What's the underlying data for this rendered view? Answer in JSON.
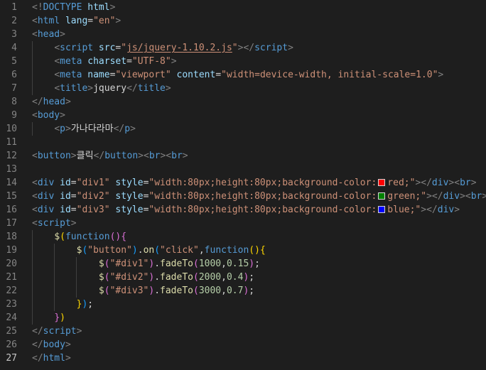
{
  "colors": {
    "background": "#1e1e1e",
    "gutter": "#858585",
    "gutter_active": "#c6c6c6",
    "tag_bracket": "#808080",
    "tag": "#569cd6",
    "attr": "#9cdcfe",
    "string": "#ce9178",
    "text": "#d4d4d4",
    "func": "#dcdcaa",
    "number": "#b5cea8",
    "bracket_gold": "#ffd700",
    "bracket_pink": "#da70d6",
    "bracket_blue": "#179fff"
  },
  "current_line": 27,
  "lines": [
    {
      "num": "1",
      "tokens": [
        {
          "t": "<!",
          "c": "tag_bracket"
        },
        {
          "t": "DOCTYPE",
          "c": "tag"
        },
        {
          "t": " html",
          "c": "attr"
        },
        {
          "t": ">",
          "c": "tag_bracket"
        }
      ]
    },
    {
      "num": "2",
      "tokens": [
        {
          "t": "<",
          "c": "tag_bracket"
        },
        {
          "t": "html",
          "c": "tag"
        },
        {
          "t": " lang",
          "c": "attr"
        },
        {
          "t": "=",
          "c": "text"
        },
        {
          "t": "\"en\"",
          "c": "string"
        },
        {
          "t": ">",
          "c": "tag_bracket"
        }
      ]
    },
    {
      "num": "3",
      "tokens": [
        {
          "t": "<",
          "c": "tag_bracket"
        },
        {
          "t": "head",
          "c": "tag"
        },
        {
          "t": ">",
          "c": "tag_bracket"
        }
      ]
    },
    {
      "num": "4",
      "tokens": [
        {
          "t": "    ",
          "c": "text"
        },
        {
          "t": "<",
          "c": "tag_bracket"
        },
        {
          "t": "script",
          "c": "tag"
        },
        {
          "t": " src",
          "c": "attr"
        },
        {
          "t": "=",
          "c": "text"
        },
        {
          "t": "\"",
          "c": "string"
        },
        {
          "t": "js/jquery-1.10.2.js",
          "c": "string",
          "u": true
        },
        {
          "t": "\"",
          "c": "string"
        },
        {
          "t": "></",
          "c": "tag_bracket"
        },
        {
          "t": "script",
          "c": "tag"
        },
        {
          "t": ">",
          "c": "tag_bracket"
        }
      ]
    },
    {
      "num": "5",
      "tokens": [
        {
          "t": "    ",
          "c": "text"
        },
        {
          "t": "<",
          "c": "tag_bracket"
        },
        {
          "t": "meta",
          "c": "tag"
        },
        {
          "t": " charset",
          "c": "attr"
        },
        {
          "t": "=",
          "c": "text"
        },
        {
          "t": "\"UTF-8\"",
          "c": "string"
        },
        {
          "t": ">",
          "c": "tag_bracket"
        }
      ]
    },
    {
      "num": "6",
      "tokens": [
        {
          "t": "    ",
          "c": "text"
        },
        {
          "t": "<",
          "c": "tag_bracket"
        },
        {
          "t": "meta",
          "c": "tag"
        },
        {
          "t": " name",
          "c": "attr"
        },
        {
          "t": "=",
          "c": "text"
        },
        {
          "t": "\"viewport\"",
          "c": "string"
        },
        {
          "t": " content",
          "c": "attr"
        },
        {
          "t": "=",
          "c": "text"
        },
        {
          "t": "\"width=device-width, initial-scale=1.0\"",
          "c": "string"
        },
        {
          "t": ">",
          "c": "tag_bracket"
        }
      ]
    },
    {
      "num": "7",
      "tokens": [
        {
          "t": "    ",
          "c": "text"
        },
        {
          "t": "<",
          "c": "tag_bracket"
        },
        {
          "t": "title",
          "c": "tag"
        },
        {
          "t": ">",
          "c": "tag_bracket"
        },
        {
          "t": "jquery",
          "c": "text"
        },
        {
          "t": "</",
          "c": "tag_bracket"
        },
        {
          "t": "title",
          "c": "tag"
        },
        {
          "t": ">",
          "c": "tag_bracket"
        }
      ]
    },
    {
      "num": "8",
      "tokens": [
        {
          "t": "</",
          "c": "tag_bracket"
        },
        {
          "t": "head",
          "c": "tag"
        },
        {
          "t": ">",
          "c": "tag_bracket"
        }
      ]
    },
    {
      "num": "9",
      "tokens": [
        {
          "t": "<",
          "c": "tag_bracket"
        },
        {
          "t": "body",
          "c": "tag"
        },
        {
          "t": ">",
          "c": "tag_bracket"
        }
      ]
    },
    {
      "num": "10",
      "tokens": [
        {
          "t": "    ",
          "c": "text"
        },
        {
          "t": "<",
          "c": "tag_bracket"
        },
        {
          "t": "p",
          "c": "tag"
        },
        {
          "t": ">",
          "c": "tag_bracket"
        },
        {
          "t": "가나다라마",
          "c": "text"
        },
        {
          "t": "</",
          "c": "tag_bracket"
        },
        {
          "t": "p",
          "c": "tag"
        },
        {
          "t": ">",
          "c": "tag_bracket"
        }
      ]
    },
    {
      "num": "11",
      "tokens": []
    },
    {
      "num": "12",
      "tokens": [
        {
          "t": "<",
          "c": "tag_bracket"
        },
        {
          "t": "button",
          "c": "tag"
        },
        {
          "t": ">",
          "c": "tag_bracket"
        },
        {
          "t": "클릭",
          "c": "text"
        },
        {
          "t": "</",
          "c": "tag_bracket"
        },
        {
          "t": "button",
          "c": "tag"
        },
        {
          "t": "><",
          "c": "tag_bracket"
        },
        {
          "t": "br",
          "c": "tag"
        },
        {
          "t": "><",
          "c": "tag_bracket"
        },
        {
          "t": "br",
          "c": "tag"
        },
        {
          "t": ">",
          "c": "tag_bracket"
        }
      ]
    },
    {
      "num": "13",
      "tokens": []
    },
    {
      "num": "14",
      "tokens": [
        {
          "t": "<",
          "c": "tag_bracket"
        },
        {
          "t": "div",
          "c": "tag"
        },
        {
          "t": " id",
          "c": "attr"
        },
        {
          "t": "=",
          "c": "text"
        },
        {
          "t": "\"div1\"",
          "c": "string"
        },
        {
          "t": " style",
          "c": "attr"
        },
        {
          "t": "=",
          "c": "text"
        },
        {
          "t": "\"width:80px;height:80px;background-color:",
          "c": "string"
        },
        {
          "t": "",
          "c": "swatch",
          "color": "#ff0000"
        },
        {
          "t": "red;\"",
          "c": "string"
        },
        {
          "t": "></",
          "c": "tag_bracket"
        },
        {
          "t": "div",
          "c": "tag"
        },
        {
          "t": "><",
          "c": "tag_bracket"
        },
        {
          "t": "br",
          "c": "tag"
        },
        {
          "t": ">",
          "c": "tag_bracket"
        }
      ]
    },
    {
      "num": "15",
      "tokens": [
        {
          "t": "<",
          "c": "tag_bracket"
        },
        {
          "t": "div",
          "c": "tag"
        },
        {
          "t": " id",
          "c": "attr"
        },
        {
          "t": "=",
          "c": "text"
        },
        {
          "t": "\"div2\"",
          "c": "string"
        },
        {
          "t": " style",
          "c": "attr"
        },
        {
          "t": "=",
          "c": "text"
        },
        {
          "t": "\"width:80px;height:80px;background-color:",
          "c": "string"
        },
        {
          "t": "",
          "c": "swatch",
          "color": "#008000"
        },
        {
          "t": "green;\"",
          "c": "string"
        },
        {
          "t": "></",
          "c": "tag_bracket"
        },
        {
          "t": "div",
          "c": "tag"
        },
        {
          "t": "><",
          "c": "tag_bracket"
        },
        {
          "t": "br",
          "c": "tag"
        },
        {
          "t": ">",
          "c": "tag_bracket"
        }
      ]
    },
    {
      "num": "16",
      "tokens": [
        {
          "t": "<",
          "c": "tag_bracket"
        },
        {
          "t": "div",
          "c": "tag"
        },
        {
          "t": " id",
          "c": "attr"
        },
        {
          "t": "=",
          "c": "text"
        },
        {
          "t": "\"div3\"",
          "c": "string"
        },
        {
          "t": " style",
          "c": "attr"
        },
        {
          "t": "=",
          "c": "text"
        },
        {
          "t": "\"width:80px;height:80px;background-color:",
          "c": "string"
        },
        {
          "t": "",
          "c": "swatch",
          "color": "#0000ff"
        },
        {
          "t": "blue;\"",
          "c": "string"
        },
        {
          "t": "></",
          "c": "tag_bracket"
        },
        {
          "t": "div",
          "c": "tag"
        },
        {
          "t": ">",
          "c": "tag_bracket"
        }
      ]
    },
    {
      "num": "17",
      "tokens": [
        {
          "t": "<",
          "c": "tag_bracket"
        },
        {
          "t": "script",
          "c": "tag"
        },
        {
          "t": ">",
          "c": "tag_bracket"
        }
      ]
    },
    {
      "num": "18",
      "tokens": [
        {
          "t": "    ",
          "c": "text"
        },
        {
          "t": "$",
          "c": "func"
        },
        {
          "t": "(",
          "c": "bracket_gold"
        },
        {
          "t": "function",
          "c": "tag"
        },
        {
          "t": "()",
          "c": "bracket_pink"
        },
        {
          "t": "{",
          "c": "bracket_pink"
        }
      ]
    },
    {
      "num": "19",
      "tokens": [
        {
          "t": "        ",
          "c": "text"
        },
        {
          "t": "$",
          "c": "func"
        },
        {
          "t": "(",
          "c": "bracket_blue"
        },
        {
          "t": "\"button\"",
          "c": "string"
        },
        {
          "t": ")",
          "c": "bracket_blue"
        },
        {
          "t": ".",
          "c": "text"
        },
        {
          "t": "on",
          "c": "func"
        },
        {
          "t": "(",
          "c": "bracket_blue"
        },
        {
          "t": "\"click\"",
          "c": "string"
        },
        {
          "t": ",",
          "c": "text"
        },
        {
          "t": "function",
          "c": "tag"
        },
        {
          "t": "()",
          "c": "bracket_gold"
        },
        {
          "t": "{",
          "c": "bracket_gold"
        }
      ]
    },
    {
      "num": "20",
      "tokens": [
        {
          "t": "            ",
          "c": "text"
        },
        {
          "t": "$",
          "c": "func"
        },
        {
          "t": "(",
          "c": "bracket_pink"
        },
        {
          "t": "\"#div1\"",
          "c": "string"
        },
        {
          "t": ")",
          "c": "bracket_pink"
        },
        {
          "t": ".",
          "c": "text"
        },
        {
          "t": "fadeTo",
          "c": "func"
        },
        {
          "t": "(",
          "c": "bracket_pink"
        },
        {
          "t": "1000",
          "c": "number"
        },
        {
          "t": ",",
          "c": "text"
        },
        {
          "t": "0.15",
          "c": "number"
        },
        {
          "t": ")",
          "c": "bracket_pink"
        },
        {
          "t": ";",
          "c": "text"
        }
      ]
    },
    {
      "num": "21",
      "tokens": [
        {
          "t": "            ",
          "c": "text"
        },
        {
          "t": "$",
          "c": "func"
        },
        {
          "t": "(",
          "c": "bracket_pink"
        },
        {
          "t": "\"#div2\"",
          "c": "string"
        },
        {
          "t": ")",
          "c": "bracket_pink"
        },
        {
          "t": ".",
          "c": "text"
        },
        {
          "t": "fadeTo",
          "c": "func"
        },
        {
          "t": "(",
          "c": "bracket_pink"
        },
        {
          "t": "2000",
          "c": "number"
        },
        {
          "t": ",",
          "c": "text"
        },
        {
          "t": "0.4",
          "c": "number"
        },
        {
          "t": ")",
          "c": "bracket_pink"
        },
        {
          "t": ";",
          "c": "text"
        }
      ]
    },
    {
      "num": "22",
      "tokens": [
        {
          "t": "            ",
          "c": "text"
        },
        {
          "t": "$",
          "c": "func"
        },
        {
          "t": "(",
          "c": "bracket_pink"
        },
        {
          "t": "\"#div3\"",
          "c": "string"
        },
        {
          "t": ")",
          "c": "bracket_pink"
        },
        {
          "t": ".",
          "c": "text"
        },
        {
          "t": "fadeTo",
          "c": "func"
        },
        {
          "t": "(",
          "c": "bracket_pink"
        },
        {
          "t": "3000",
          "c": "number"
        },
        {
          "t": ",",
          "c": "text"
        },
        {
          "t": "0.7",
          "c": "number"
        },
        {
          "t": ")",
          "c": "bracket_pink"
        },
        {
          "t": ";",
          "c": "text"
        }
      ]
    },
    {
      "num": "23",
      "tokens": [
        {
          "t": "        ",
          "c": "text"
        },
        {
          "t": "}",
          "c": "bracket_gold"
        },
        {
          "t": ")",
          "c": "bracket_blue"
        },
        {
          "t": ";",
          "c": "text"
        }
      ]
    },
    {
      "num": "24",
      "tokens": [
        {
          "t": "    ",
          "c": "text"
        },
        {
          "t": "}",
          "c": "bracket_pink"
        },
        {
          "t": ")",
          "c": "bracket_gold"
        }
      ]
    },
    {
      "num": "25",
      "tokens": [
        {
          "t": "</",
          "c": "tag_bracket"
        },
        {
          "t": "script",
          "c": "tag"
        },
        {
          "t": ">",
          "c": "tag_bracket"
        }
      ]
    },
    {
      "num": "26",
      "tokens": [
        {
          "t": "</",
          "c": "tag_bracket"
        },
        {
          "t": "body",
          "c": "tag"
        },
        {
          "t": ">",
          "c": "tag_bracket"
        }
      ]
    },
    {
      "num": "27",
      "tokens": [
        {
          "t": "</",
          "c": "tag_bracket"
        },
        {
          "t": "html",
          "c": "tag"
        },
        {
          "t": ">",
          "c": "tag_bracket"
        }
      ]
    }
  ]
}
